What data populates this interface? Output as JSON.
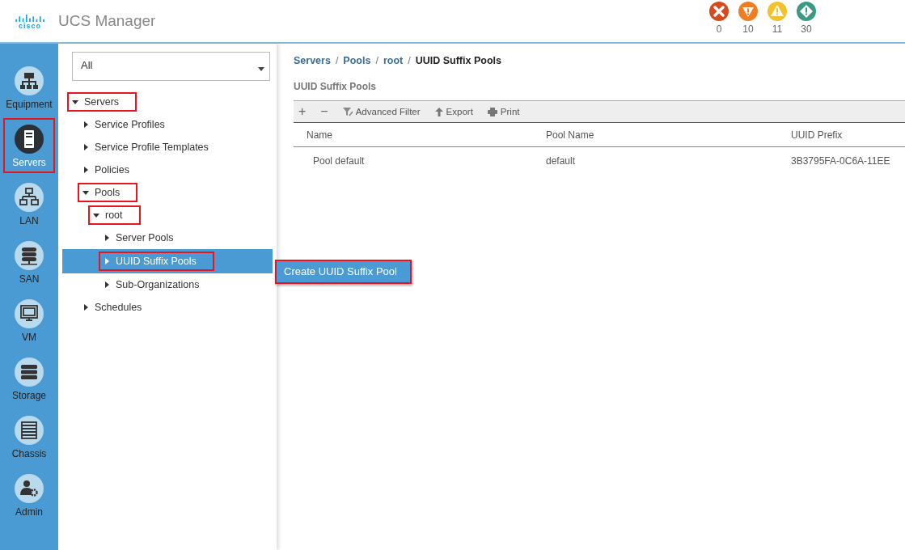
{
  "header": {
    "logo": "cisco",
    "title": "UCS Manager",
    "faults": [
      {
        "kind": "critical",
        "count": "0"
      },
      {
        "kind": "major",
        "count": "10"
      },
      {
        "kind": "minor",
        "count": "11"
      },
      {
        "kind": "warning",
        "count": "30"
      }
    ]
  },
  "nav": [
    {
      "kind": "equipment",
      "label": "Equipment",
      "selected": false,
      "highlighted": false
    },
    {
      "kind": "servers",
      "label": "Servers",
      "selected": true,
      "highlighted": true
    },
    {
      "kind": "lan",
      "label": "LAN",
      "selected": false,
      "highlighted": false
    },
    {
      "kind": "san",
      "label": "SAN",
      "selected": false,
      "highlighted": false
    },
    {
      "kind": "vm",
      "label": "VM",
      "selected": false,
      "highlighted": false
    },
    {
      "kind": "storage",
      "label": "Storage",
      "selected": false,
      "highlighted": false
    },
    {
      "kind": "chassis",
      "label": "Chassis",
      "selected": false,
      "highlighted": false
    },
    {
      "kind": "admin",
      "label": "Admin",
      "selected": false,
      "highlighted": false
    }
  ],
  "filter": {
    "value": "All"
  },
  "tree": [
    {
      "label": "Servers",
      "expanded": true,
      "selected": false,
      "highlighted": true,
      "children": [
        {
          "label": "Service Profiles",
          "expanded": false,
          "selected": false,
          "highlighted": false
        },
        {
          "label": "Service Profile Templates",
          "expanded": false,
          "selected": false,
          "highlighted": false
        },
        {
          "label": "Policies",
          "expanded": false,
          "selected": false,
          "highlighted": false
        },
        {
          "label": "Pools",
          "expanded": true,
          "selected": false,
          "highlighted": true,
          "children": [
            {
              "label": "root",
              "expanded": true,
              "selected": false,
              "highlighted": true,
              "children": [
                {
                  "label": "Server Pools",
                  "expanded": false,
                  "selected": false,
                  "highlighted": false
                },
                {
                  "label": "UUID Suffix Pools",
                  "expanded": false,
                  "selected": true,
                  "highlighted": true
                },
                {
                  "label": "Sub-Organizations",
                  "expanded": false,
                  "selected": false,
                  "highlighted": false
                }
              ]
            }
          ]
        },
        {
          "label": "Schedules",
          "expanded": false,
          "selected": false,
          "highlighted": false
        }
      ]
    }
  ],
  "context_menu": {
    "items": [
      {
        "label": "Create UUID Suffix Pool",
        "highlighted": true
      }
    ]
  },
  "breadcrumb": {
    "separator": "/",
    "items": [
      "Servers",
      "Pools",
      "root",
      "UUID Suffix Pools"
    ]
  },
  "panel_title": "UUID Suffix Pools",
  "toolbar": [
    {
      "kind": "add",
      "label": "+"
    },
    {
      "kind": "remove",
      "label": "−"
    },
    {
      "kind": "filter",
      "label": "Advanced Filter"
    },
    {
      "kind": "export",
      "label": "Export"
    },
    {
      "kind": "print",
      "label": "Print"
    }
  ],
  "table": {
    "columns": [
      "Name",
      "Pool Name",
      "UUID Prefix"
    ],
    "rows": [
      [
        "Pool default",
        "default",
        "3B3795FA-0C6A-11EE"
      ]
    ]
  }
}
